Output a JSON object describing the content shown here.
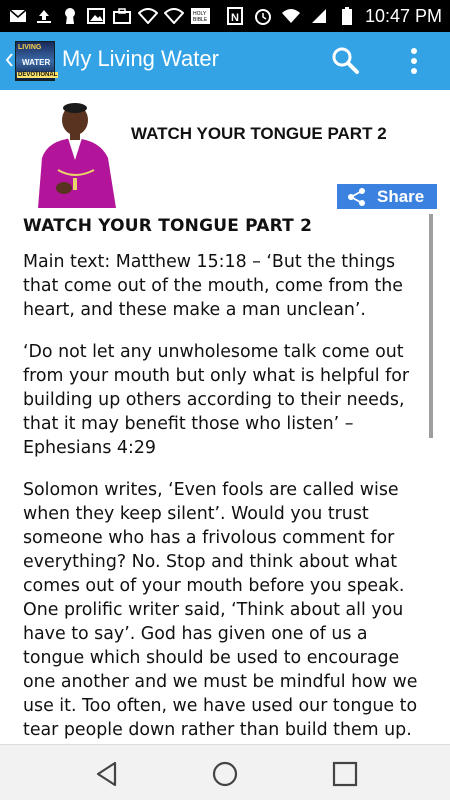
{
  "status_bar": {
    "time": "10:47 PM",
    "left_icons": [
      "email-icon",
      "upload-icon",
      "keyhole-icon",
      "image-icon",
      "briefcase-icon",
      "wifi-icon",
      "wifi-icon",
      "bible-icon"
    ],
    "right_icons": [
      "nfc-icon",
      "alarm-icon",
      "wifi-icon",
      "signal-icon",
      "battery-icon"
    ]
  },
  "app_bar": {
    "title": "My Living Water",
    "logo_text_top": "LIVING",
    "logo_text_mid": "WATER",
    "logo_text_bottom": "DEVOTIONAL",
    "color": "#33a3e6"
  },
  "header": {
    "title": "WATCH YOUR TONGUE PART 2",
    "share_label": "Share",
    "share_color": "#3b82e0"
  },
  "article": {
    "title": "WATCH YOUR TONGUE PART 2",
    "paragraphs": [
      "Main text: Matthew 15:18 – ‘But the things that come out of the mouth, come from the heart, and these make a man unclean’.",
      "‘Do not let any unwholesome talk come out from your mouth but only what is helpful for building up others according to their needs, that it may benefit those who listen’ – Ephesians 4:29",
      "Solomon writes, ‘Even fools are called wise when they keep silent’. Would you trust someone who has a frivolous comment for everything? No. Stop and think about what comes out of your mouth before you speak. One prolific writer said, ‘Think about all you have to say’. God has given one of us a tongue which should be used to encourage one another and we must be mindful how we use it. Too often, we have used our tongue to tear people down rather than build them up."
    ]
  },
  "nav_bar": {
    "buttons": [
      "back-icon",
      "home-icon",
      "recents-icon"
    ]
  }
}
